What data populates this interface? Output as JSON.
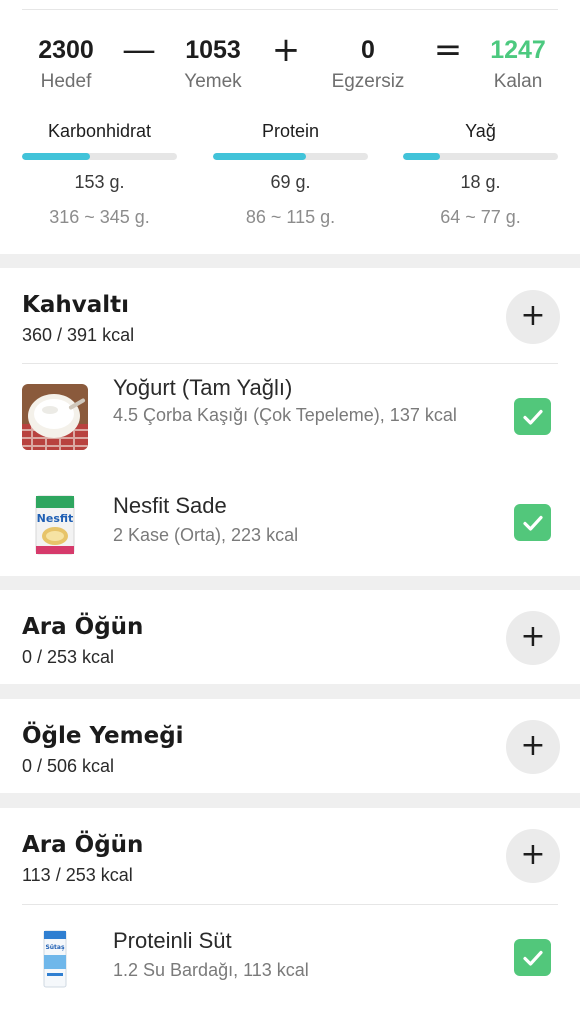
{
  "summary": {
    "target": {
      "value": "2300",
      "label": "Hedef"
    },
    "op_minus": "—",
    "food": {
      "value": "1053",
      "label": "Yemek"
    },
    "op_plus": "+",
    "exercise": {
      "value": "0",
      "label": "Egzersiz"
    },
    "op_equals": "=",
    "remaining": {
      "value": "1247",
      "label": "Kalan"
    },
    "accent_color": "#4cc97f"
  },
  "macros": [
    {
      "name": "Karbonhidrat",
      "value": "153 g.",
      "range": "316 ~ 345 g.",
      "progress": 0.44
    },
    {
      "name": "Protein",
      "value": "69 g.",
      "range": "86 ~ 115 g.",
      "progress": 0.6
    },
    {
      "name": "Yağ",
      "value": "18 g.",
      "range": "64 ~ 77 g.",
      "progress": 0.24
    }
  ],
  "bar_color": "#41c3d9",
  "meals": [
    {
      "title": "Kahvaltı",
      "kcal": "360 / 391 kcal",
      "add_label": "+",
      "items": [
        {
          "name": "Yoğurt (Tam Yağlı)",
          "desc": "4.5 Çorba Kaşığı (Çok Tepeleme), 137 kcal",
          "icon": "yogurt-bowl-photo",
          "checked": true
        },
        {
          "name": "Nesfit Sade",
          "desc": "2 Kase (Orta), 223 kcal",
          "icon": "cereal-box-photo",
          "checked": true
        }
      ]
    },
    {
      "title": "Ara Öğün",
      "kcal": "0 / 253 kcal",
      "add_label": "+",
      "items": []
    },
    {
      "title": "Öğle Yemeği",
      "kcal": "0 / 506 kcal",
      "add_label": "+",
      "items": []
    },
    {
      "title": "Ara Öğün",
      "kcal": "113 / 253 kcal",
      "add_label": "+",
      "items": [
        {
          "name": "Proteinli Süt",
          "desc": "1.2 Su Bardağı, 113 kcal",
          "icon": "milk-carton-photo",
          "checked": true
        }
      ]
    }
  ],
  "check_color": "#52c77b"
}
